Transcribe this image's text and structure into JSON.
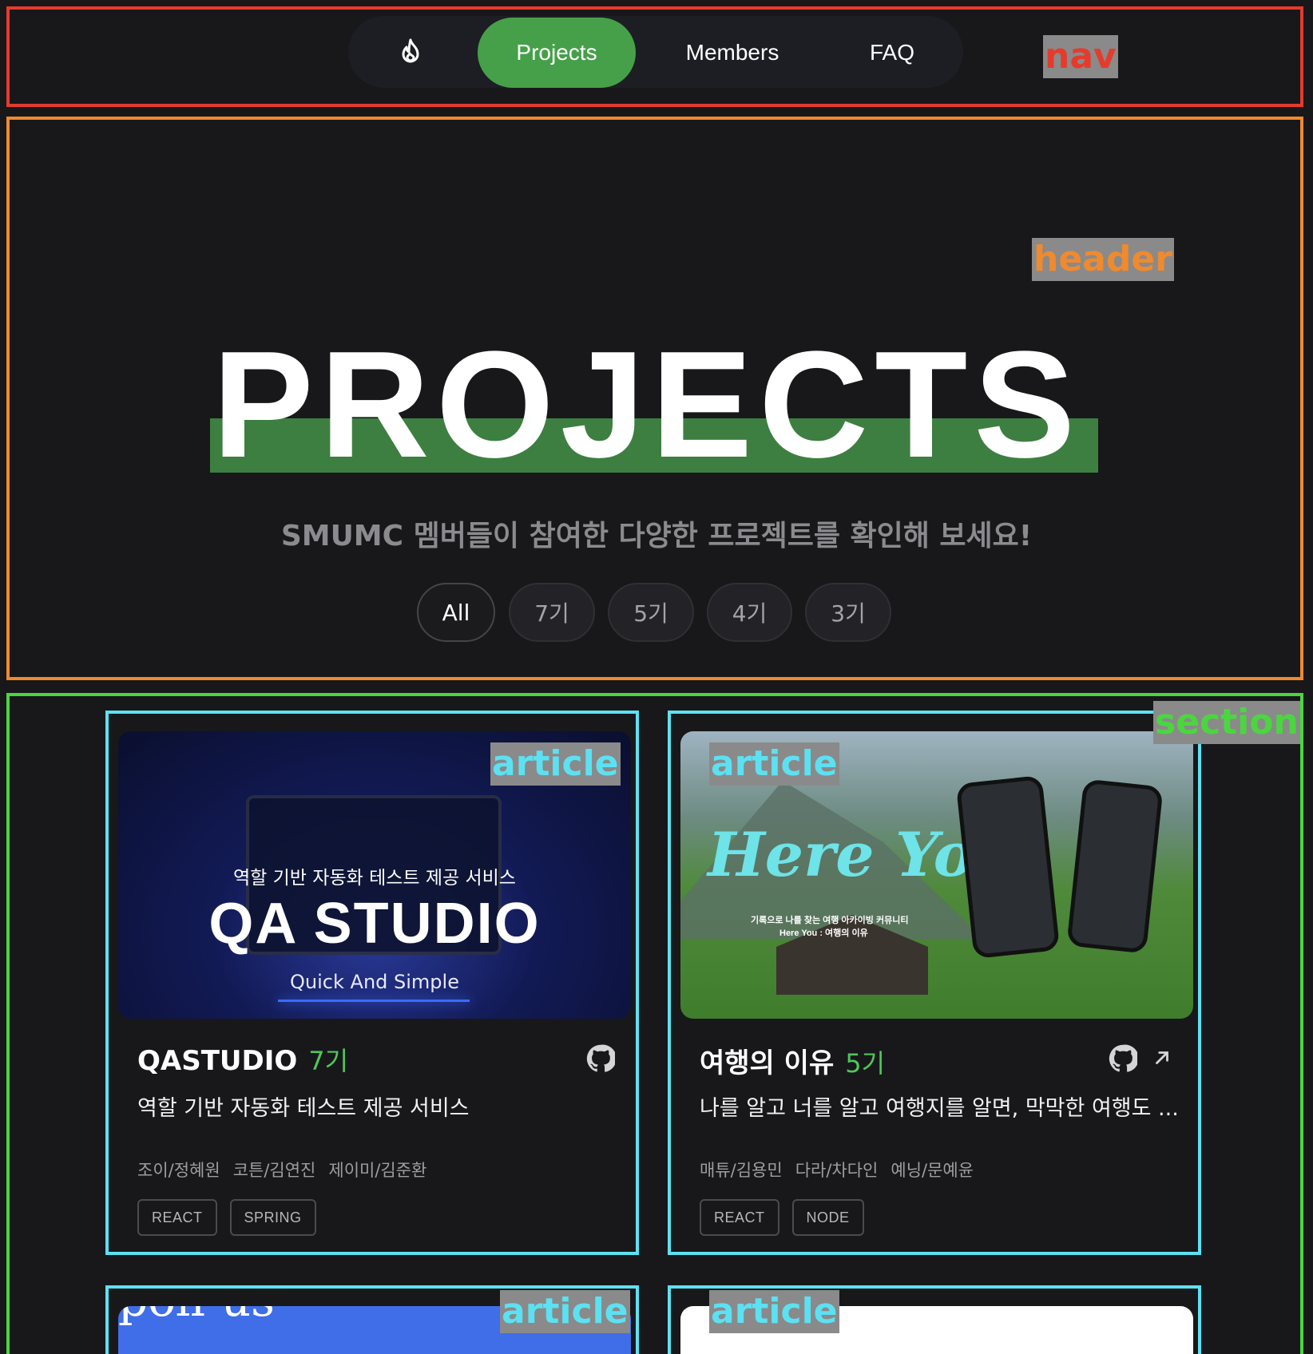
{
  "annotations": {
    "nav": "nav",
    "header": "header",
    "section": "section",
    "article": "article"
  },
  "nav": {
    "logo_icon": "flame-icon",
    "items": [
      {
        "label": "Projects",
        "active": true
      },
      {
        "label": "Members"
      },
      {
        "label": "FAQ"
      }
    ]
  },
  "header": {
    "title": "PROJECTS",
    "subtitle": "SMUMC 멤버들이 참여한 다양한 프로젝트를 확인해 보세요!",
    "filters": [
      {
        "label": "All",
        "active": true
      },
      {
        "label": "7기"
      },
      {
        "label": "5기"
      },
      {
        "label": "4기"
      },
      {
        "label": "3기"
      }
    ]
  },
  "colors": {
    "accent_green": "#46a049",
    "bar_green": "#3d7f40",
    "gen_green": "#4fc75a",
    "background": "#18181b"
  },
  "projects": [
    {
      "thumb": {
        "tagline": "역할 기반 자동화 테스트 제공 서비스",
        "logo": "QA STUDIO",
        "slogan": "Quick And Simple"
      },
      "name": "QASTUDIO",
      "generation": "7기",
      "description": "역할 기반 자동화 테스트 제공 서비스",
      "members": [
        "조이/정혜원",
        "코튼/김연진",
        "제이미/김준환"
      ],
      "tags": [
        "REACT",
        "SPRING"
      ],
      "icons": [
        "github-icon"
      ]
    },
    {
      "thumb": {
        "logo": "Here You",
        "caption_1": "기록으로 나를 찾는 여행 아카이빙 커뮤니티",
        "caption_2": "Here You : 여행의 이유"
      },
      "name": "여행의 이유",
      "generation": "5기",
      "description": "나를 알고 너를 알고 여행지를 알면, 막막한 여행도 ...",
      "members": [
        "매튜/김용민",
        "다라/차다인",
        "예닝/문예윤"
      ],
      "tags": [
        "REACT",
        "NODE"
      ],
      "icons": [
        "github-icon",
        "external-link-icon"
      ]
    },
    {
      "thumb": {
        "logo": "poll-us"
      }
    },
    {
      "thumb": {}
    }
  ]
}
